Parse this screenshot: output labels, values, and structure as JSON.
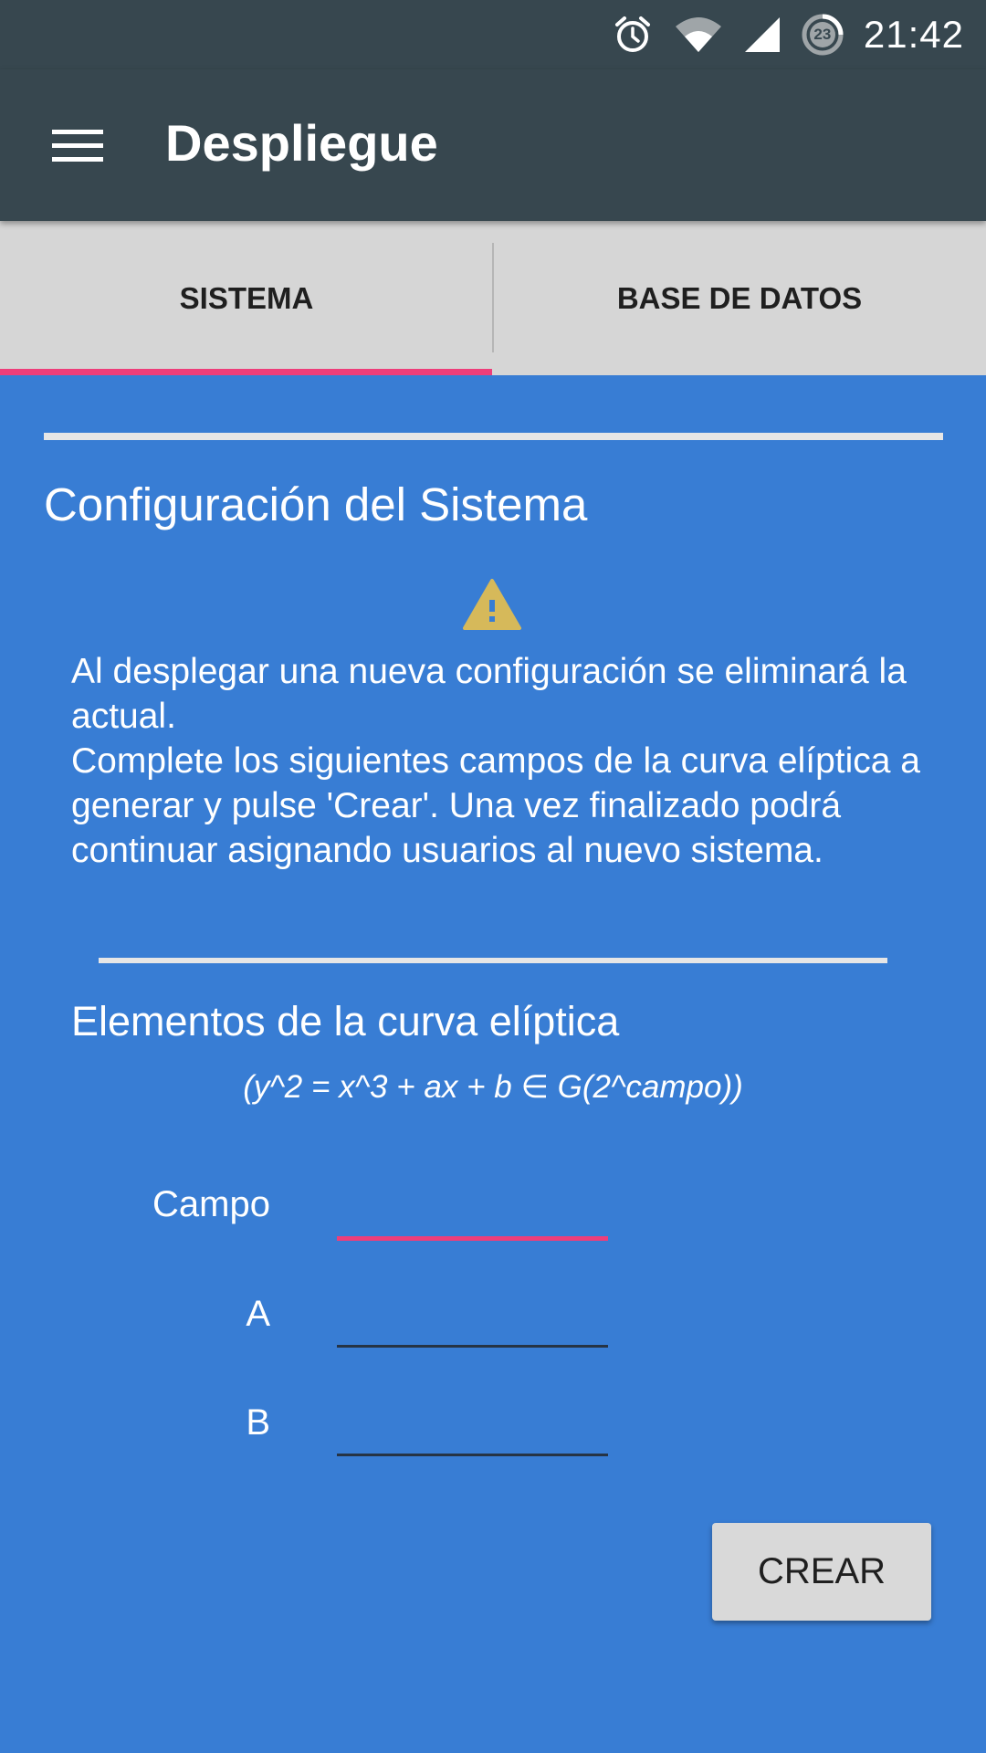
{
  "status_bar": {
    "time": "21:42",
    "notification_badge": "23",
    "icons": [
      "alarm-icon",
      "wifi-icon",
      "signal-icon",
      "data-saver-icon"
    ]
  },
  "app_bar": {
    "title": "Despliegue",
    "menu_icon": "hamburger-menu-icon"
  },
  "tabs": [
    {
      "label": "SISTEMA",
      "selected": true
    },
    {
      "label": "BASE DE DATOS",
      "selected": false
    }
  ],
  "main": {
    "section_title": "Configuración del Sistema",
    "warning_icon": "warning-icon",
    "message_lines": [
      "Al desplegar una nueva configuración se eliminará la actual.",
      "Complete los siguientes campos de la curva elíptica a generar y pulse 'Crear'. Una vez finalizado podrá continuar asignando usuarios al nuevo sistema."
    ],
    "subtitle": "Elementos de la curva elíptica",
    "formula": "(y^2 = x^3 + ax + b  ∈ G(2^campo))",
    "fields": [
      {
        "label": "Campo",
        "value": "",
        "focused": true
      },
      {
        "label": "A",
        "value": "",
        "focused": false
      },
      {
        "label": "B",
        "value": "",
        "focused": false
      }
    ],
    "create_button": "CREAR"
  },
  "colors": {
    "status_bar": "#37474f",
    "app_bar": "#37474f",
    "tab_bar": "#d6d6d6",
    "tab_indicator": "#ee3e7a",
    "content_background": "#387dd4",
    "warning": "#d6b95a",
    "button": "#d9d9d9"
  }
}
